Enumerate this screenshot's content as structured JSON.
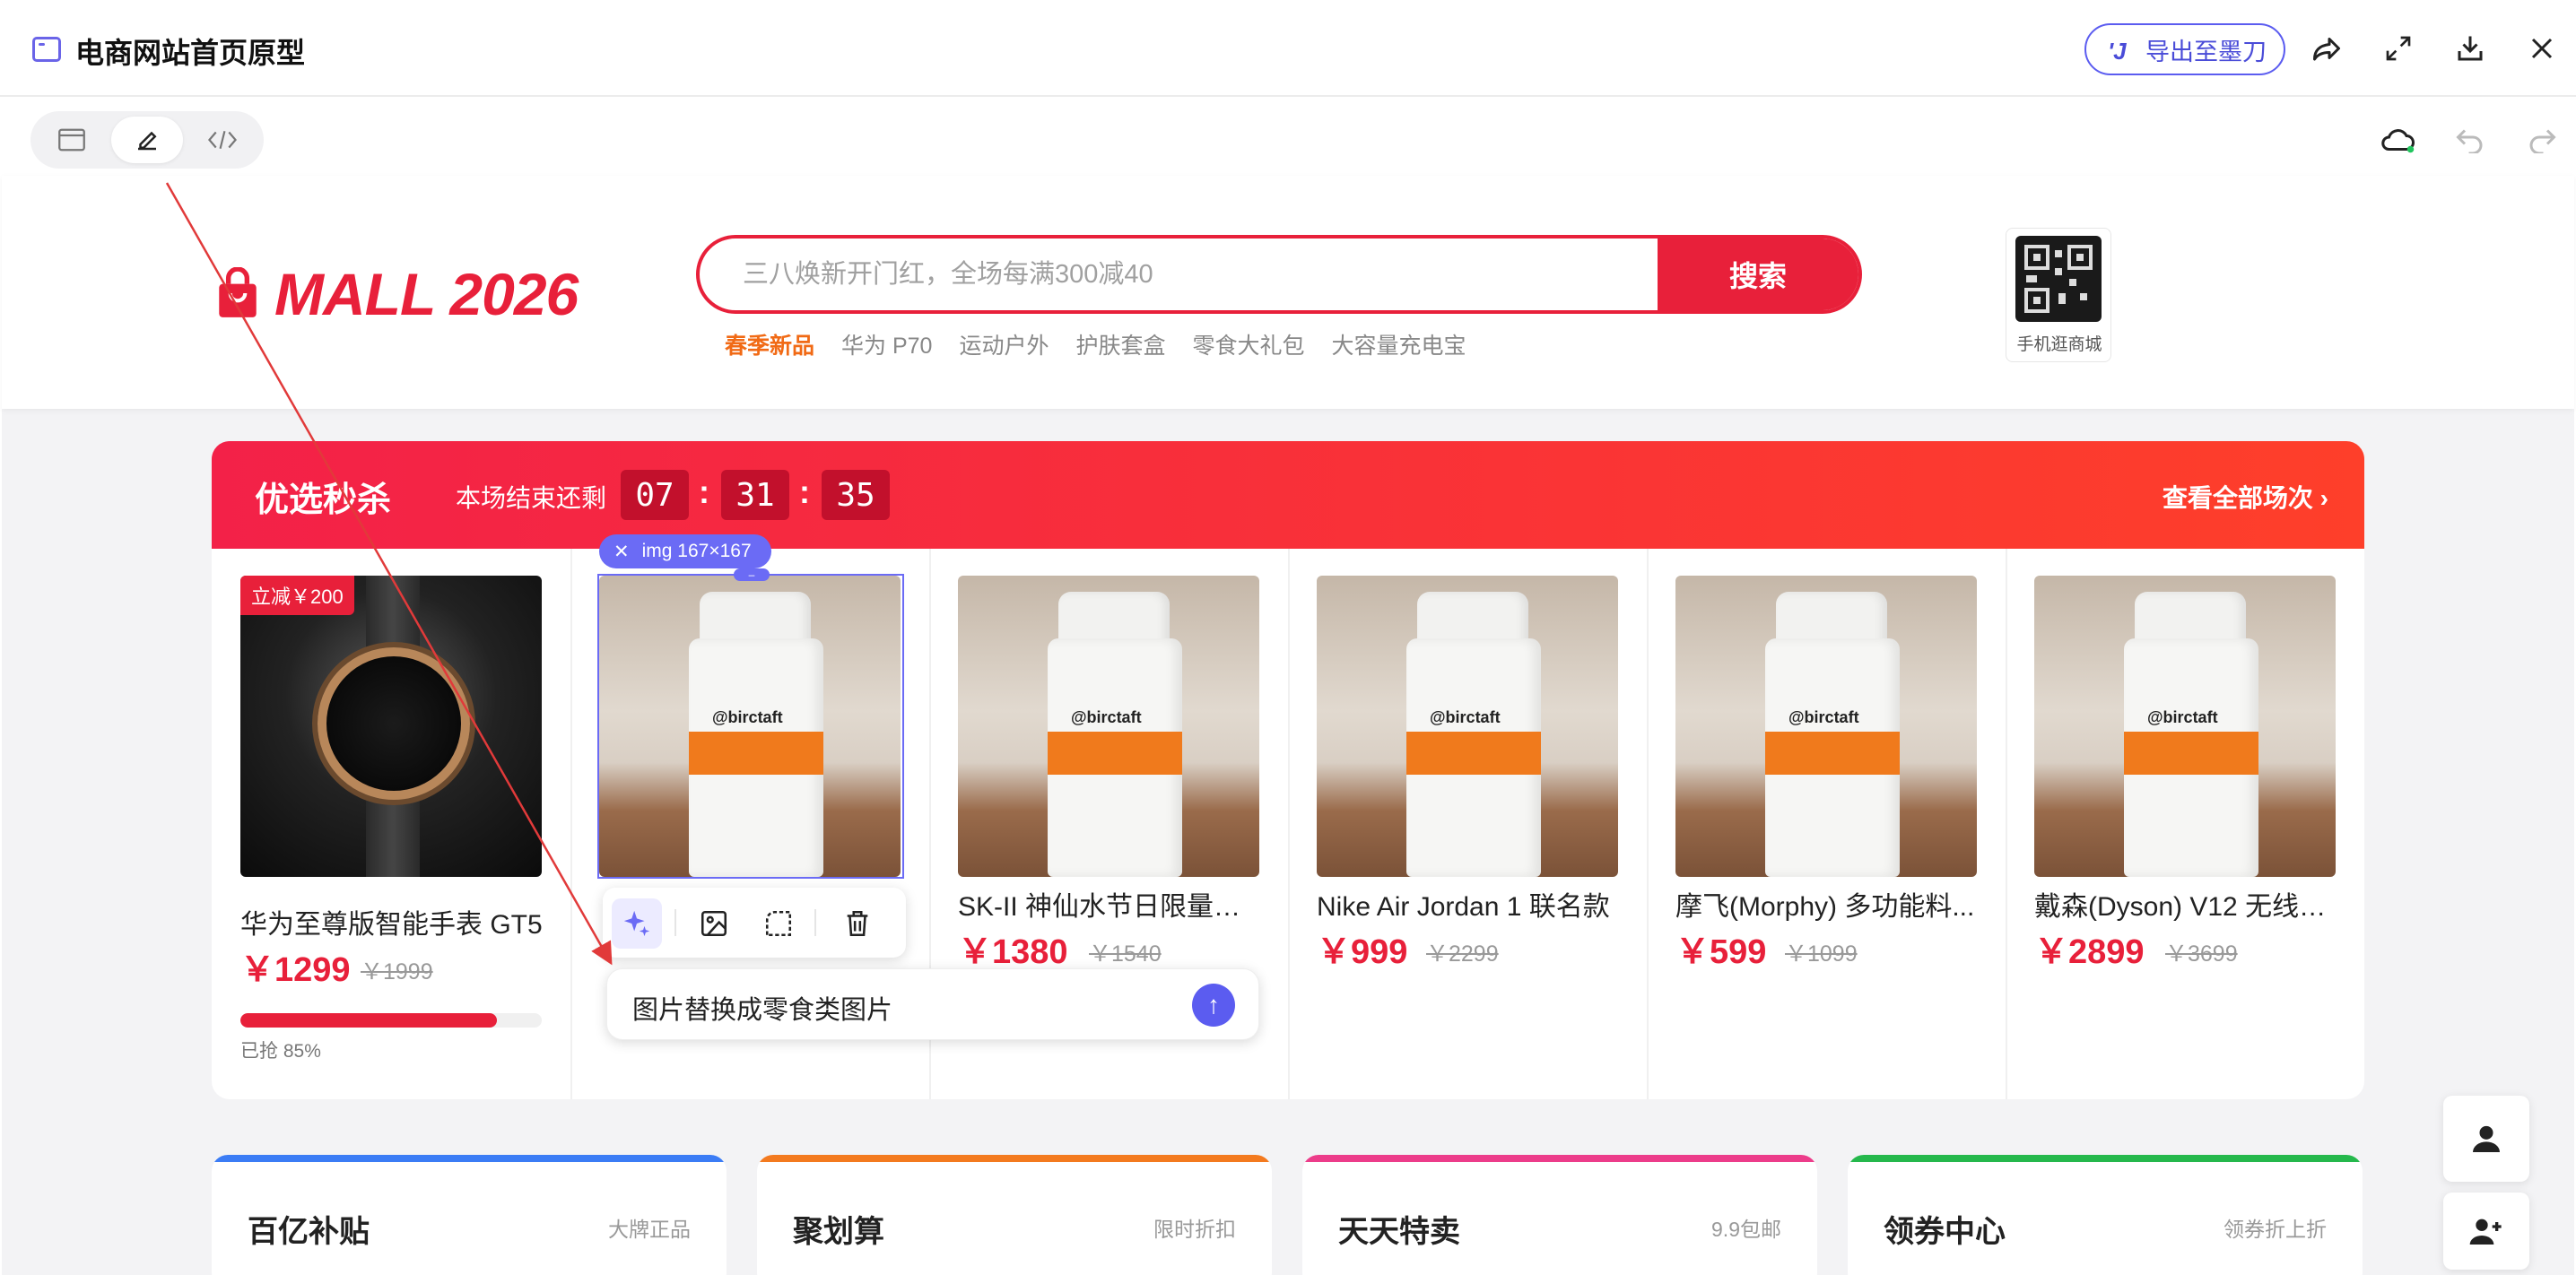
{
  "window": {
    "title": "电商网站首页原型",
    "export_label": "导出至墨刀"
  },
  "header": {
    "logo": "MALL 2026",
    "search_placeholder": "三八焕新开门红，全场每满300减40",
    "search_button": "搜索",
    "hot_words": [
      "春季新品",
      "华为 P70",
      "运动户外",
      "护肤套盒",
      "零食大礼包",
      "大容量充电宝"
    ],
    "qr_label": "手机逛商城"
  },
  "flash_sale": {
    "title": "优选秒杀",
    "subtitle": "本场结束还剩",
    "countdown": [
      "07",
      "31",
      "35"
    ],
    "view_all": "查看全部场次 ›",
    "products": [
      {
        "name": "华为至尊版智能手表 GT5",
        "price": "￥1299",
        "old_price": "￥1999",
        "badge": "立减￥200",
        "progress_label": "已抢 85%",
        "progress": 0.85
      },
      {
        "name": "",
        "price": "",
        "old_price": ""
      },
      {
        "name": "SK-II 神仙水节日限量版...",
        "price": "￥1380",
        "old_price": "￥1540"
      },
      {
        "name": "Nike Air Jordan 1 联名款",
        "price": "￥999",
        "old_price": "￥2299"
      },
      {
        "name": "摩飞(Morphy) 多功能料...",
        "price": "￥599",
        "old_price": "￥1099"
      },
      {
        "name": "戴森(Dyson) V12 无线吸...",
        "price": "￥2899",
        "old_price": "￥3699"
      }
    ]
  },
  "selection": {
    "tag": "img 167×167",
    "prompt": "图片替换成零食类图片"
  },
  "bottom_cards": [
    {
      "title": "百亿补贴",
      "sub": "大牌正品",
      "color": "#3b7cf5"
    },
    {
      "title": "聚划算",
      "sub": "限时折扣",
      "color": "#f37a1f"
    },
    {
      "title": "天天特卖",
      "sub": "9.9包邮",
      "color": "#ec3c8a"
    },
    {
      "title": "领券中心",
      "sub": "领券折上折",
      "color": "#25b84c"
    }
  ],
  "colors": {
    "accent": "#e8203a",
    "editor": "#5b5cf0"
  }
}
